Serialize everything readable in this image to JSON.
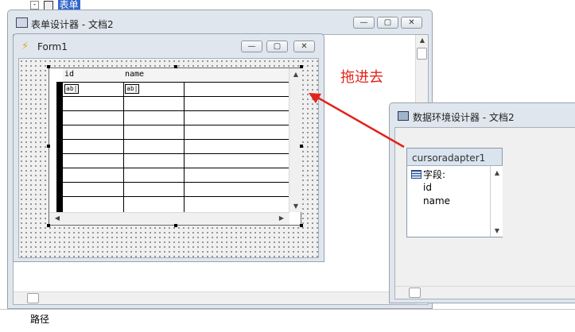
{
  "tree": {
    "toggle": "-",
    "label": "表单"
  },
  "path_label": "路径",
  "form_designer": {
    "title": "表单设计器 - 文档2"
  },
  "form1": {
    "title": "Form1",
    "grid": {
      "columns": [
        "id",
        "name"
      ],
      "cell_placeholder": "ab|"
    }
  },
  "data_env": {
    "title": "数据环境设计器 - 文档2",
    "cursor": {
      "name": "cursoradapter1",
      "fields_header": "字段:",
      "fields": [
        "id",
        "name"
      ]
    }
  },
  "annotation": {
    "text": "拖进去",
    "color": "#e2231a"
  },
  "window_buttons": {
    "minimize": "—",
    "maximize": "▢",
    "close": "✕"
  }
}
